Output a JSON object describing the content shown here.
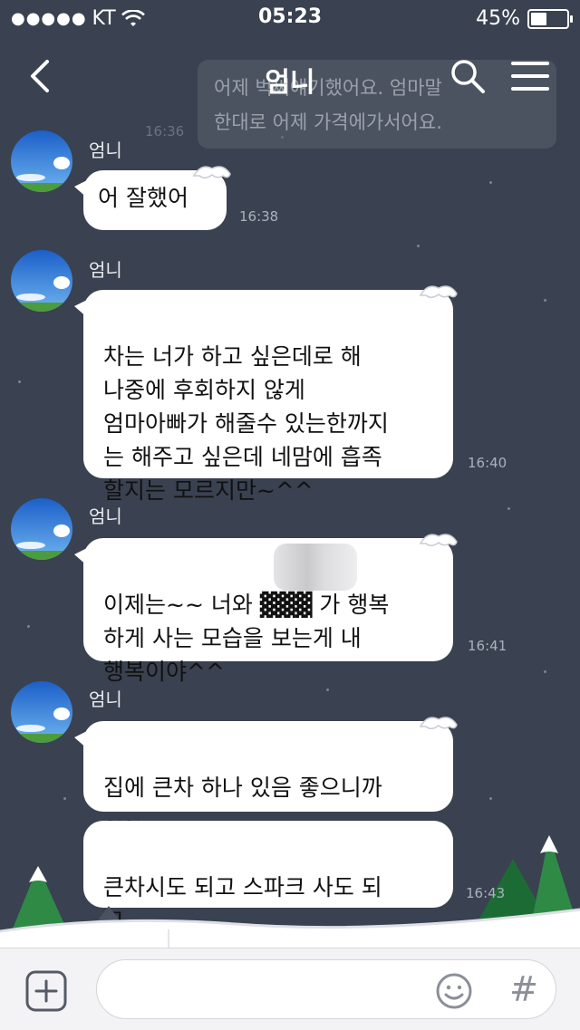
{
  "status_bar": {
    "signal": "●●●●●",
    "carrier": "KT",
    "time": "05:23",
    "battery": "45%",
    "battery_level": 0.45
  },
  "header": {
    "title": "엄니",
    "back_icon": "back-chevron-icon",
    "search_icon": "search-icon",
    "menu_icon": "hamburger-menu-icon"
  },
  "preview": {
    "line1": "어제 벅써얘기했어요. 엄마말",
    "line2": "한대로 어제 가격에가서어요.",
    "time": "16:36"
  },
  "messages": [
    {
      "sender": "엄니",
      "bubbles": [
        "어 잘했어"
      ],
      "time": "16:38"
    },
    {
      "sender": "엄니",
      "bubbles": [
        "차는 너가 하고 싶은데로 해\n나중에 후회하지 않게\n엄마아빠가 해줄수 있는한까지\n는 해주고 싶은데 네맘에 흡족\n할지는 모르지만~^^"
      ],
      "time": "16:40"
    },
    {
      "sender": "엄니",
      "bubbles": [
        "이제는~~ 너와 ▓▓▓ 가 행복\n하게 사는 모습을 보는게 내\n행복이야^^"
      ],
      "time": "16:41"
    },
    {
      "sender": "엄니",
      "bubbles": [
        "집에 큰차 하나 있음 좋으니까\n~~",
        "큰차시도 되고 스파크 사도 되\n고"
      ],
      "time": "16:43"
    }
  ],
  "input_bar": {
    "add_icon": "plus-square-icon",
    "emoji_icon": "smiley-icon",
    "hash_label": "#"
  }
}
